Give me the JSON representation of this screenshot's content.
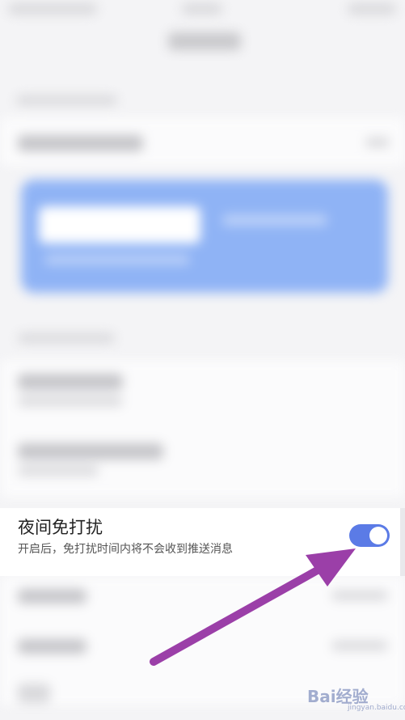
{
  "dnd": {
    "title": "夜间免打扰",
    "subtitle": "开启后，免打扰时间内将不会收到推送消息",
    "enabled": true
  },
  "colors": {
    "toggle_on": "#5b7be6",
    "arrow": "#9b3fa8",
    "banner": "#8fb3f5"
  },
  "watermark": {
    "text": "Bai经验",
    "sub": "jingyan.baidu.com"
  }
}
